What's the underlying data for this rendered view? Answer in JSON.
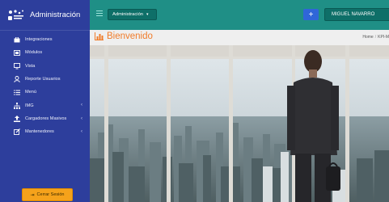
{
  "app": {
    "title": "Administración"
  },
  "sidebar": {
    "items": [
      {
        "label": "Integraciones",
        "icon": "briefcase-icon",
        "has_children": false
      },
      {
        "label": "Módulos",
        "icon": "modules-icon",
        "has_children": false
      },
      {
        "label": "Vista",
        "icon": "monitor-icon",
        "has_children": false
      },
      {
        "label": "Reporte Usuarios",
        "icon": "user-icon",
        "has_children": false
      },
      {
        "label": "Menú",
        "icon": "list-icon",
        "has_children": false
      },
      {
        "label": "IMG",
        "icon": "sitemap-icon",
        "has_children": true
      },
      {
        "label": "Cargadores Masivos",
        "icon": "upload-icon",
        "has_children": true
      },
      {
        "label": "Mantenedores",
        "icon": "edit-icon",
        "has_children": true
      }
    ],
    "logout_label": "Cerrar Sesión"
  },
  "topbar": {
    "module_dropdown": "Administración",
    "add_label": "+",
    "user_label": "MIGUEL NAVARRO"
  },
  "page": {
    "title": "Bienvenido",
    "breadcrumb": [
      "Home",
      "KPI-M"
    ]
  },
  "colors": {
    "sidebar": "#2d3e9c",
    "topbar": "#1f8f86",
    "accent_orange": "#f07c2b",
    "logout": "#f5a21b",
    "add_button": "#2f66d8"
  }
}
